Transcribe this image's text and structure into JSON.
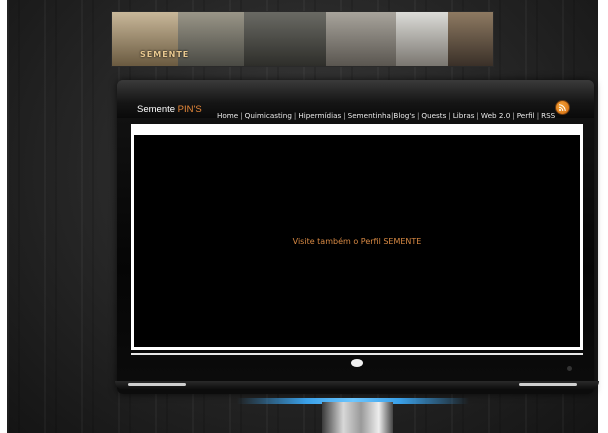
{
  "banner": {
    "logo_text": "SEMENTE"
  },
  "header": {
    "brand_primary": "Semente",
    "brand_accent": "PIN'S",
    "nav": [
      "Home",
      "Quimicasting",
      "Hipermídias",
      "Sementinha",
      "Blog's",
      "Quests",
      "Libras",
      "Web 2.0",
      "Perfil",
      "RSS"
    ]
  },
  "screen": {
    "promo_text": "Visite também o Perfil SEMENTE"
  },
  "colors": {
    "accent": "#e8893a",
    "screen": "#000000",
    "promo": "#d98a44",
    "stand_glow": "#3aa0e8"
  },
  "icons": {
    "rss": "rss-icon",
    "tv_logo": "tv-logo-icon",
    "power": "power-icon"
  }
}
